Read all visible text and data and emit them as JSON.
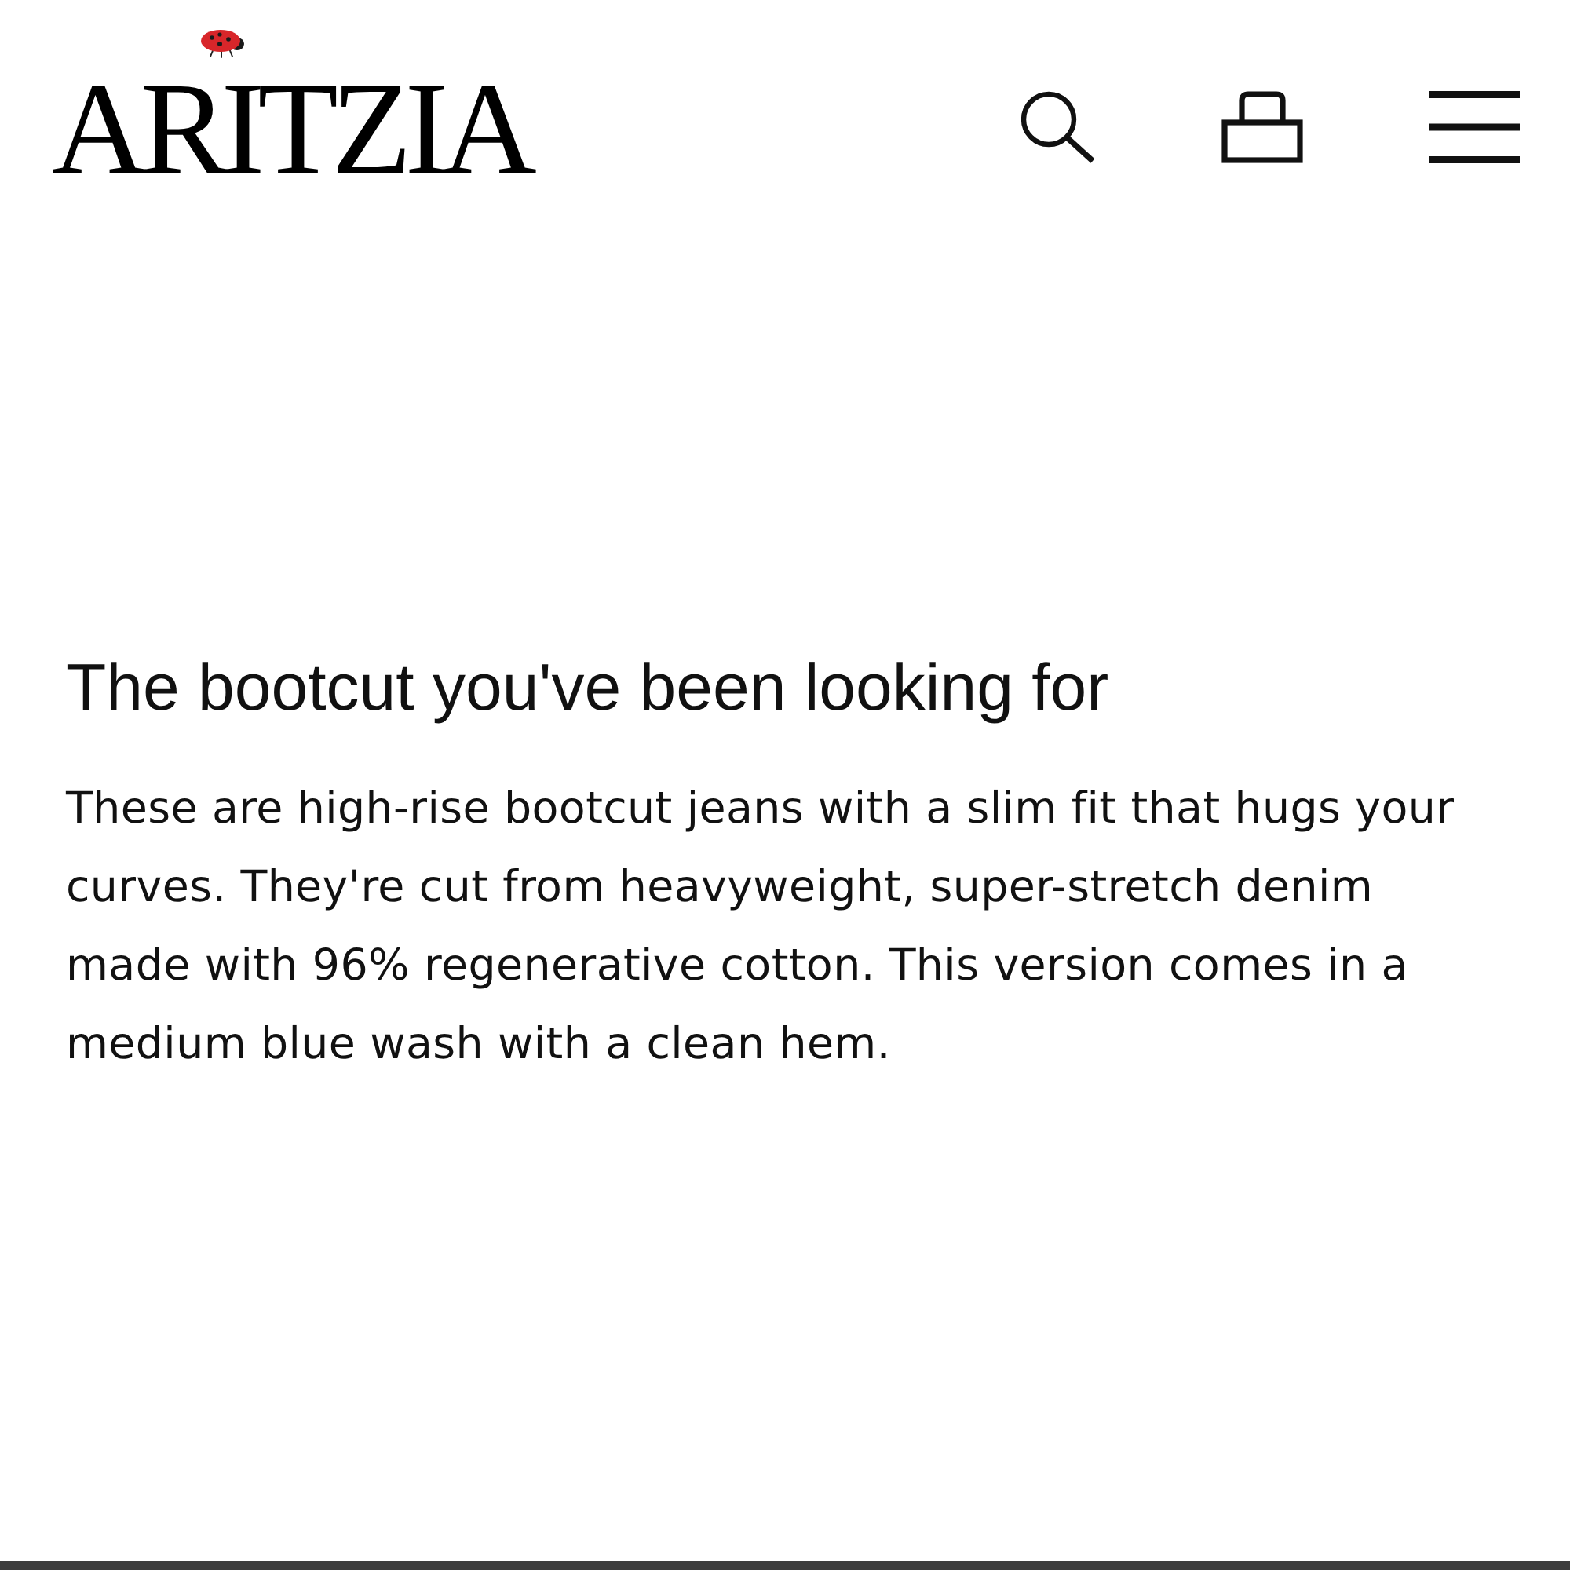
{
  "header": {
    "logo": "ARITZIA"
  },
  "product_description": {
    "heading": "The bootcut you've been looking for",
    "body": "These are high-rise bootcut jeans with a slim fit that hugs your curves. They're cut from heavyweight, super-stretch denim made with 96% regenerative cotton. This version comes in a medium blue wash with a clean hem."
  }
}
